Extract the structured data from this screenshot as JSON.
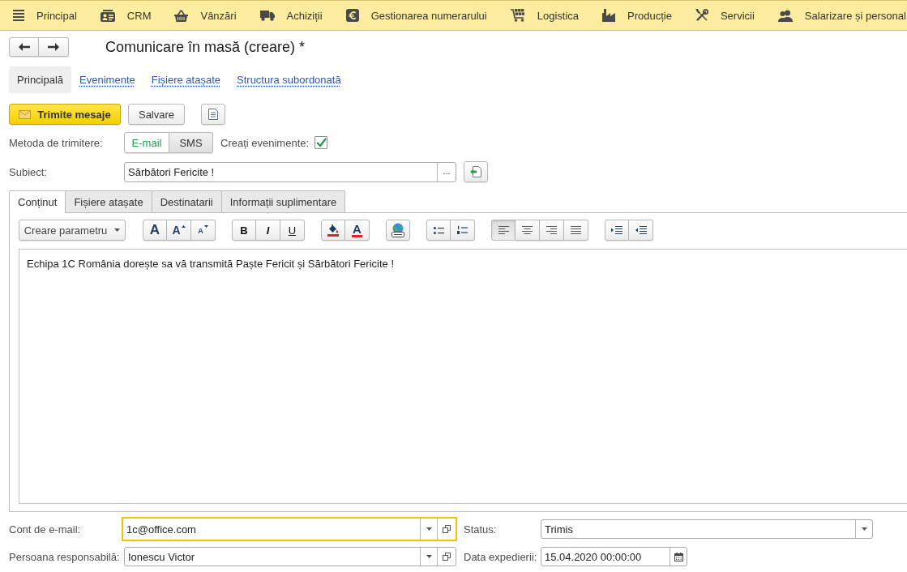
{
  "menu": [
    {
      "kind": "menu",
      "label": "Principal"
    },
    {
      "kind": "contacts",
      "label": "CRM"
    },
    {
      "kind": "basket",
      "label": "Vânzări"
    },
    {
      "kind": "truck",
      "label": "Achiziții"
    },
    {
      "kind": "euro",
      "label": "Gestionarea numerarului"
    },
    {
      "kind": "cart",
      "label": "Logistica"
    },
    {
      "kind": "factory",
      "label": "Producție"
    },
    {
      "kind": "tools",
      "label": "Servicii"
    },
    {
      "kind": "people",
      "label": "Salarizare și personal"
    }
  ],
  "form": {
    "title": "Comunicare în masă (creare) *",
    "sections": [
      {
        "label": "Principală",
        "selected": true
      },
      {
        "label": "Evenimente",
        "selected": false
      },
      {
        "label": "Fișiere atașate",
        "selected": false
      },
      {
        "label": "Structura subordonată",
        "selected": false
      }
    ],
    "commands": {
      "send_button": "Trimite mesaje",
      "save_button": "Salvare"
    },
    "send_method": {
      "label": "Metoda de trimitere:",
      "options": [
        {
          "label": "E-mail",
          "selected": true
        },
        {
          "label": "SMS",
          "selected": false
        }
      ]
    },
    "create_events": {
      "label": "Creați evenimente:",
      "checked": true
    },
    "subject": {
      "label": "Subiect:",
      "value": "Sărbători Fericite !",
      "choice_button": "..."
    },
    "tabs": [
      {
        "label": "Conținut",
        "selected": true
      },
      {
        "label": "Fișiere atașate",
        "selected": false
      },
      {
        "label": "Destinatarii",
        "selected": false
      },
      {
        "label": "Informații suplimentare",
        "selected": false
      }
    ],
    "editor": {
      "toolbar": {
        "insert_button": "Creare parametru",
        "groups": [
          {
            "buttons": [
              {
                "kind": "font",
                "label": "A"
              },
              {
                "kind": "grow",
                "label": "A"
              },
              {
                "kind": "shrink",
                "label": "A"
              }
            ]
          },
          {
            "buttons": [
              {
                "kind": "bold",
                "label": "B"
              },
              {
                "kind": "italic",
                "label": "I"
              },
              {
                "kind": "underline",
                "label": "U"
              }
            ]
          },
          {
            "buttons": [
              {
                "kind": "fill-color"
              },
              {
                "kind": "font-color",
                "label": "A"
              }
            ]
          },
          {
            "buttons": [
              {
                "kind": "image"
              }
            ]
          },
          {
            "buttons": [
              {
                "kind": "bullets"
              },
              {
                "kind": "numbering"
              }
            ]
          },
          {
            "buttons": [
              {
                "kind": "align-left",
                "selected": true
              },
              {
                "kind": "align-center",
                "selected": false
              },
              {
                "kind": "align-right",
                "selected": false
              },
              {
                "kind": "justify",
                "selected": false
              }
            ]
          },
          {
            "buttons": [
              {
                "kind": "indent"
              },
              {
                "kind": "outdent"
              }
            ]
          }
        ]
      },
      "text": "Echipa 1C România dorește sa vă transmită Paște Fericit și Sărbători Fericite !"
    },
    "fields": [
      {
        "kind": "reference",
        "label": "Cont de e-mail:",
        "value": "1c@office.com",
        "focused": true
      },
      {
        "kind": "select",
        "label": "Status:",
        "value": "Trimis",
        "focused": false
      },
      {
        "kind": "reference",
        "label": "Persoana responsabilă:",
        "value": "Ionescu Victor",
        "focused": false
      },
      {
        "kind": "date",
        "label": "Data expedierii:",
        "value": "15.04.2020 00:00:00",
        "focused": false
      }
    ]
  }
}
